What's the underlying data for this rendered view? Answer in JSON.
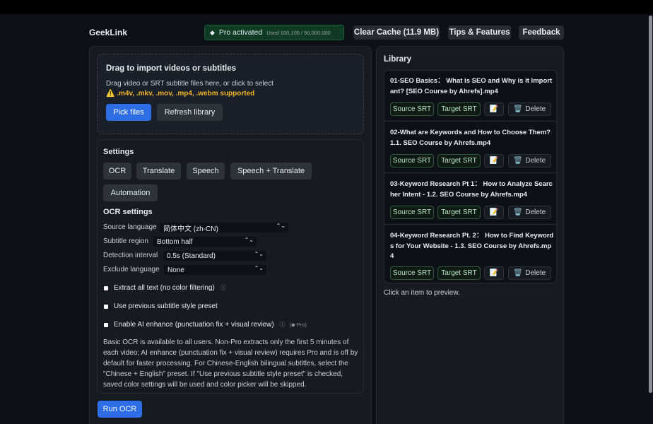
{
  "header": {
    "brand": "GeekLink",
    "pro_label": "Pro activated",
    "pro_usage": "Used 100,105 / 50,000,000",
    "clear_cache": "Clear Cache (11.9 MB)",
    "tips": "Tips & Features",
    "feedback": "Feedback"
  },
  "import": {
    "title": "Drag to import videos or subtitles",
    "subtitle": "Drag video or SRT subtitle files here, or click to select",
    "formats": "⚠️ .m4v, .mkv, .mov, .mp4, .webm supported",
    "pick_files": "Pick files",
    "refresh": "Refresh library"
  },
  "settings": {
    "title": "Settings",
    "tabs": [
      "OCR",
      "Translate",
      "Speech",
      "Speech + Translate",
      "Automation"
    ],
    "ocr_title": "OCR settings",
    "source_language_label": "Source language",
    "source_language_value": "简体中文 (zh-CN)",
    "subtitle_region_label": "Subtitle region",
    "subtitle_region_value": "Bottom half",
    "detection_interval_label": "Detection interval",
    "detection_interval_value": "0.5s (Standard)",
    "exclude_language_label": "Exclude language",
    "exclude_language_value": "None",
    "extract_all_text": "Extract all text (no color filtering)",
    "use_previous_preset": "Use previous subtitle style preset",
    "ai_enhance": "Enable AI enhance (punctuation fix + visual review)",
    "pro_tag": "(◆ Pro)",
    "description": "Basic OCR is available to all users. Non-Pro extracts only the first 5 minutes of each video; AI enhance (punctuation fix + visual review) requires Pro and is off by default for faster processing. For Chinese-English bilingual subtitles, select the \"Chinese + English\" preset. If \"Use previous subtitle style preset\" is checked, saved color settings will be used and color picker will be skipped.",
    "run_ocr": "Run OCR"
  },
  "library": {
    "title": "Library",
    "items": [
      {
        "name": "01-SEO Basics： What is SEO and Why is it Important?  [SEO Course by Ahrefs].mp4"
      },
      {
        "name": "02-What are Keywords and How to Choose Them?  1.1. SEO Course by Ahrefs.mp4"
      },
      {
        "name": "03-Keyword Research Pt 1： How to Analyze Searcher Intent - 1.2. SEO Course by Ahrefs.mp4"
      },
      {
        "name": "04-Keyword Research Pt. 2： How to Find Keywords for Your Website - 1.3. SEO Course by Ahrefs.mp4"
      }
    ],
    "source_srt": "Source SRT",
    "target_srt": "Target SRT",
    "edit_icon": "📝",
    "delete_label": "Delete",
    "hint": "Click an item to preview."
  }
}
